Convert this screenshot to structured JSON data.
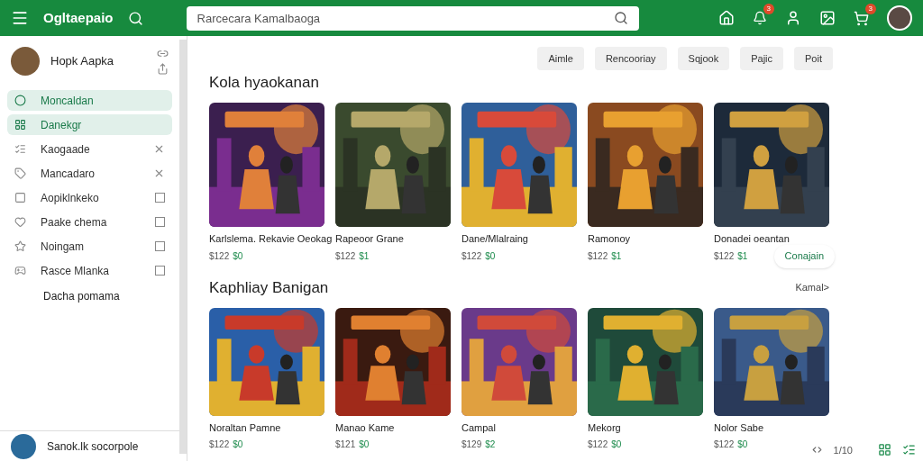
{
  "header": {
    "brand": "Ogltaepaio",
    "search": {
      "placeholder": "Rarcecara Kamalbaoga"
    },
    "badges": [
      "3",
      "3"
    ]
  },
  "sidebar": {
    "user": {
      "name": "Hopk Aapka"
    },
    "items": [
      {
        "label": "Moncaldan",
        "selected": true,
        "kind": "plain"
      },
      {
        "label": "Danekgr",
        "selected": true,
        "kind": "plain"
      },
      {
        "label": "Kaogaade",
        "selected": false,
        "kind": "closable"
      },
      {
        "label": "Mancadaro",
        "selected": false,
        "kind": "closable"
      },
      {
        "label": "Aopiklnkeko",
        "selected": false,
        "kind": "checkbox",
        "checked": false
      },
      {
        "label": "Paake chema",
        "selected": false,
        "kind": "checkbox",
        "checked": false
      },
      {
        "label": "Noingam",
        "selected": false,
        "kind": "checkbox",
        "checked": false
      },
      {
        "label": "Rasce Mlanka",
        "selected": false,
        "kind": "checkbox",
        "checked": false
      }
    ],
    "note": "Dacha pomama",
    "footer_user": "Sanok.lk socorpole"
  },
  "filters": [
    {
      "label": "Aimle"
    },
    {
      "label": "Rencooriay"
    },
    {
      "label": "Sqjook"
    },
    {
      "label": "Pajic"
    },
    {
      "label": "Poit"
    }
  ],
  "sections": [
    {
      "title": "Kola hyaokanan",
      "games": [
        {
          "name": "Karlslema. Rekavie Oeokag",
          "price": "$122",
          "tag": "$0"
        },
        {
          "name": "Rapeoor Grane",
          "price": "$122",
          "tag": "$1"
        },
        {
          "name": "Dane/Mlalraing",
          "price": "$122",
          "tag": "$0"
        },
        {
          "name": "Ramonoy",
          "price": "$122",
          "tag": "$1"
        },
        {
          "name": "Donadei oeantan",
          "price": "$122",
          "tag": "$1"
        }
      ],
      "action": "Conajain"
    },
    {
      "title": "Kaphliay Banigan",
      "more": "Kamal>",
      "games": [
        {
          "name": "Noraltan Pamne",
          "price": "$122",
          "tag": "$0"
        },
        {
          "name": "Manao Kame",
          "price": "$121",
          "tag": "$0"
        },
        {
          "name": "Campal",
          "price": "$129",
          "tag": "$2"
        },
        {
          "name": "Mekorg",
          "price": "$122",
          "tag": "$0"
        },
        {
          "name": "Nolor Sabe",
          "price": "$122",
          "tag": "$0"
        }
      ]
    }
  ],
  "pager": "1/10"
}
